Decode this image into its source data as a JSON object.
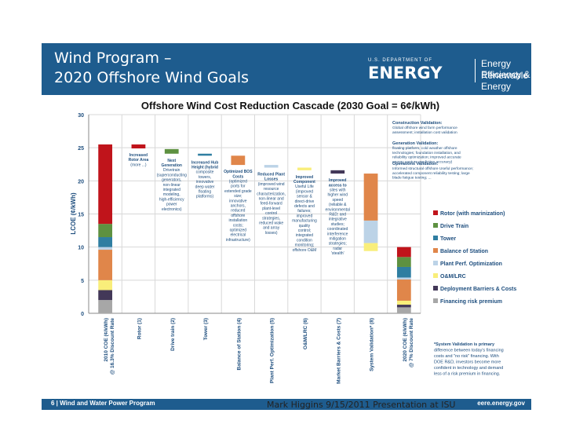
{
  "header": {
    "title_line1": "Wind Program –",
    "title_line2": "2020 Offshore Wind Goals",
    "doe_small": "U.S. DEPARTMENT OF",
    "doe_big": "ENERGY",
    "eere_line1": "Energy Efficiency &",
    "eere_line2": "Renewable Energy"
  },
  "footer": {
    "left": "6 | Wind and Water Power Program",
    "right": "eere.energy.gov"
  },
  "caption": "Mark Higgins 9/15/2011 Presentation at ISU",
  "chart_data": {
    "type": "bar",
    "subtype": "waterfall",
    "title": "Offshore Wind Cost Reduction Cascade (2030 Goal = 6¢/kWh)",
    "ylabel": "LCOE (¢/kWh)",
    "ylim": [
      0,
      30
    ],
    "yticks": [
      0,
      5,
      10,
      15,
      20,
      25,
      30
    ],
    "grid": true,
    "legend_position": "right",
    "categories": [
      "2010 COE (¢/kWh) @ 16.3% Discount Rate",
      "Rotor (1)",
      "Drive train (2)",
      "Tower (3)",
      "Balance of Station (4)",
      "Plant Perf. Optimization (5)",
      "O&M/LRC (6)",
      "Market Barriers & Costs (7)",
      "System Validation* (8)",
      "2020 COE (¢/kWh) @ 7% Discount Rate"
    ],
    "components": [
      {
        "name": "Rotor (with marinization)",
        "color": "#c0141b"
      },
      {
        "name": "Drive Train",
        "color": "#5e9141"
      },
      {
        "name": "Tower",
        "color": "#2f7ea1"
      },
      {
        "name": "Balance of Station",
        "color": "#e0864a"
      },
      {
        "name": "Plant Perf. Optimization",
        "color": "#bcd3e7"
      },
      {
        "name": "O&M/LRC",
        "color": "#f9ee7a"
      },
      {
        "name": "Deployment Barriers & Costs",
        "color": "#433858"
      },
      {
        "name": "Financing risk premium",
        "color": "#a7a7a7"
      }
    ],
    "stack_2010": [
      12,
      2,
      1.5,
      4.6,
      0.4,
      1.5,
      1.5,
      2
    ],
    "stack_2020": [
      1.5,
      1.5,
      1.6,
      3.2,
      0.3,
      0.6,
      0.4,
      0.9
    ],
    "steps": [
      {
        "from": 25.5,
        "to": 24.9,
        "color": "#c0141b"
      },
      {
        "from": 24.8,
        "to": 24.1,
        "color": "#5e9141"
      },
      {
        "from": 24.1,
        "to": 23.8,
        "color": "#2f7ea1"
      },
      {
        "from": 23.8,
        "to": 22.4,
        "color": "#e0864a"
      },
      {
        "from": 22.4,
        "to": 22.0,
        "color": "#bcd3e7"
      },
      {
        "from": 22.0,
        "to": 21.6,
        "color": "#f9ee7a"
      },
      {
        "from": 21.6,
        "to": 21.1,
        "color": "#433858"
      }
    ],
    "system_validation": [
      {
        "from": 21.1,
        "to": 14.0,
        "color": "#e0864a"
      },
      {
        "from": 14.0,
        "to": 10.6,
        "color": "#bcd3e7"
      },
      {
        "from": 10.6,
        "to": 9.4,
        "color": "#f9ee7a"
      }
    ],
    "step_annotations": [
      "Increased Rotor Area (more ...)",
      "Next Generation Drivetrain (superconducting generators, non-linear integrated modeling, high-efficiency power electronics)",
      "Increased Hub Height (hybrid composite towers, innovative deep water floating platforms)",
      "Optimized BOS Costs (optimized ports for extended grade size; innovative anchors, reduced offshore installation costs; optimized electrical infrastructure)",
      "Reduced Plant Losses (improved wind resource characterization, non-linear and feed-forward plant-level control strategies, reduced wake and array losses)",
      "Improved Component Useful Life (improved sensor & direct-drive defects and failures; improved manufacturing quality control; integrated condition monitoring; offshore O&M strategies)",
      "Improved access to sites with higher wind speed (reliable & environmental R&D; and integrative studies; coordinated interference mitigation strategies; radar 'stealth' blades)"
    ],
    "right_annotations": [
      {
        "title": "Construction Validation:",
        "text": "Global offshore wind farm performance assessment; installation cost validation"
      },
      {
        "title": "Generation Validation:",
        "text": "floating platform, cold weather offshore technologies; foundation installation, and reliability optimization; improved accurate energy capture prediction accuracy)"
      },
      {
        "title": "Operations Validation:",
        "text": "Informed structural offshore Useful performance; accelerated component reliability testing; large blade fatigue testing; ..."
      }
    ],
    "footnote": "*System Validation is primary difference between today's financing costs and \"no risk\" financing. With DOE R&D, investors become more confident in technology and demand less of a risk premium in financing."
  }
}
